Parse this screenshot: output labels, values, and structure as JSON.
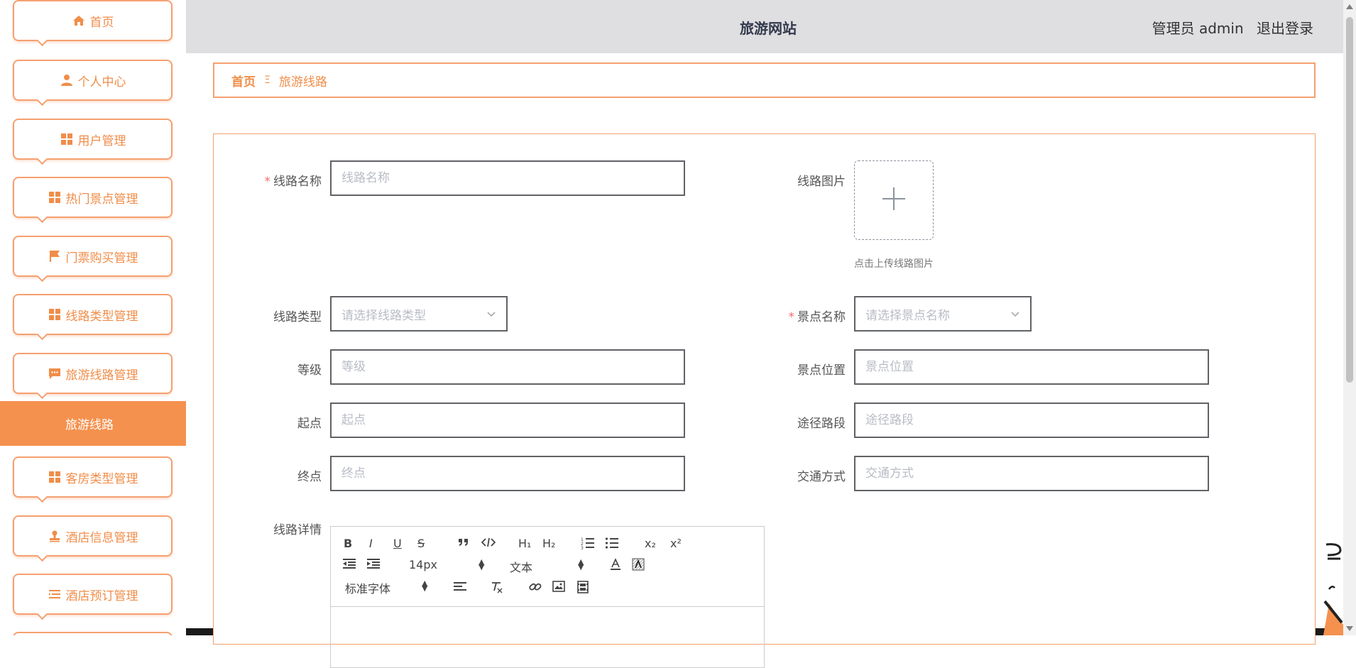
{
  "sidebar": {
    "items": [
      {
        "label": "首页",
        "icon": "home-icon"
      },
      {
        "label": "个人中心",
        "icon": "user-icon"
      },
      {
        "label": "用户管理",
        "icon": "grid-icon"
      },
      {
        "label": "热门景点管理",
        "icon": "grid-icon"
      },
      {
        "label": "门票购买管理",
        "icon": "flag-icon"
      },
      {
        "label": "线路类型管理",
        "icon": "grid-icon"
      },
      {
        "label": "旅游线路管理",
        "icon": "chat-icon"
      },
      {
        "label": "客房类型管理",
        "icon": "grid-icon"
      },
      {
        "label": "酒店信息管理",
        "icon": "stamp-icon"
      },
      {
        "label": "酒店预订管理",
        "icon": "list-icon"
      }
    ],
    "active_sub": "旅游线路"
  },
  "header": {
    "title": "旅游网站",
    "role": "管理员 admin",
    "logout": "退出登录"
  },
  "breadcrumb": {
    "home": "首页",
    "separator": "Ξ",
    "current": "旅游线路"
  },
  "form": {
    "route_name": {
      "label": "线路名称",
      "placeholder": "线路名称",
      "required": true
    },
    "route_image": {
      "label": "线路图片",
      "tip": "点击上传线路图片"
    },
    "route_type": {
      "label": "线路类型",
      "placeholder": "请选择线路类型"
    },
    "spot_name": {
      "label": "景点名称",
      "placeholder": "请选择景点名称",
      "required": true
    },
    "level": {
      "label": "等级",
      "placeholder": "等级"
    },
    "spot_location": {
      "label": "景点位置",
      "placeholder": "景点位置"
    },
    "start": {
      "label": "起点",
      "placeholder": "起点"
    },
    "via": {
      "label": "途径路段",
      "placeholder": "途径路段"
    },
    "end": {
      "label": "终点",
      "placeholder": "终点"
    },
    "transport": {
      "label": "交通方式",
      "placeholder": "交通方式"
    },
    "detail": {
      "label": "线路详情"
    }
  },
  "editor": {
    "font_size": "14px",
    "header_select": "文本",
    "font_family": "标准字体",
    "buttons": {
      "bold": "B",
      "italic": "I",
      "underline": "U",
      "strike": "S",
      "h1": "H₁",
      "h2": "H₂",
      "sub": "x₂",
      "sup": "x²"
    }
  },
  "colors": {
    "accent": "#f08d49",
    "accent_active": "#f5914e",
    "header_bg": "#dfdfe2",
    "required": "#f56c6c"
  }
}
